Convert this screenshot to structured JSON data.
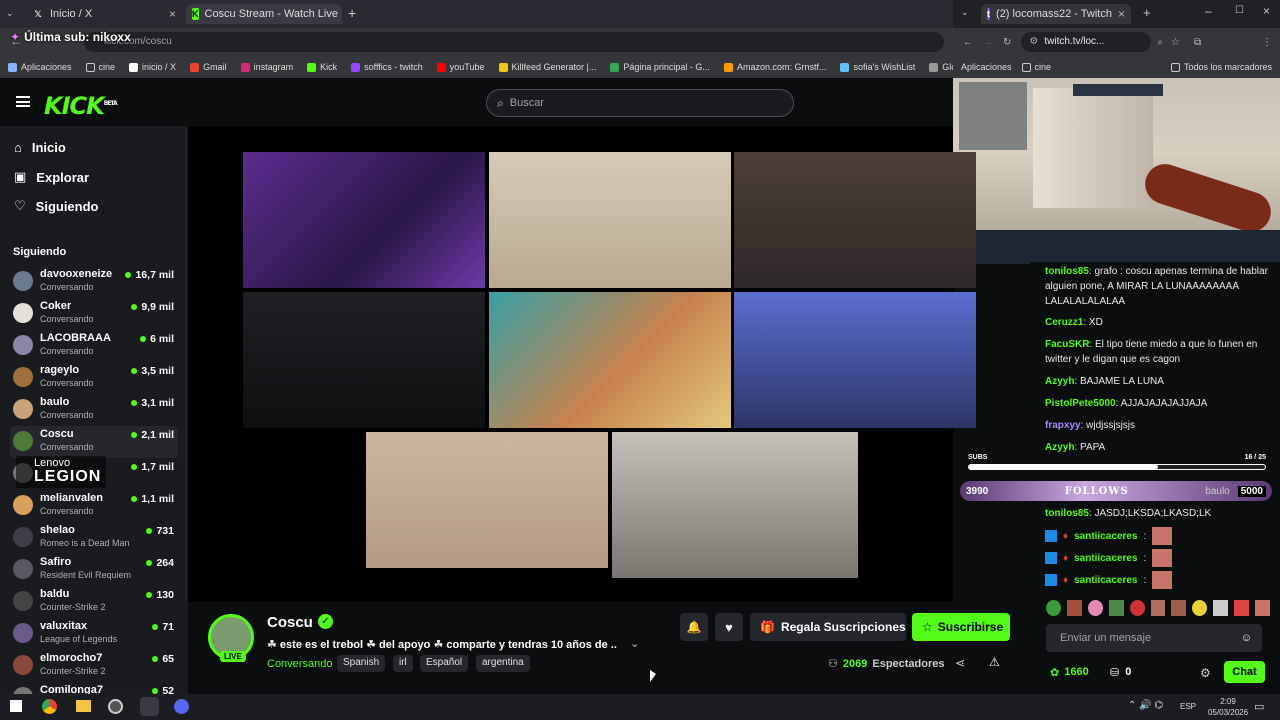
{
  "overlay": {
    "last_sub": "Última sub: nikoxx"
  },
  "browser_left": {
    "tabs": [
      {
        "label": "Inicio / X"
      },
      {
        "label": "Coscu Stream - Watch Live"
      }
    ],
    "url": "kick.com/coscu",
    "bookmarks": [
      "Aplicaciones",
      "cine",
      "inicio / X",
      "Gmail",
      "instagram",
      "Kick",
      "sofffics - twitch",
      "youTube",
      "Killfeed Generator |...",
      "Página principal - G...",
      "Amazon.com: Grnstf...",
      "sofia's WishList",
      "Glock-18 | Shinobi"
    ]
  },
  "browser_right": {
    "tab": "(2) locomass22 - Twitch",
    "url": "twitch.tv/loc...",
    "bookmarks": [
      "Aplicaciones",
      "cine",
      "Todos los marcadores"
    ]
  },
  "kick": {
    "logo": "KICK",
    "logo_badge": "BETA",
    "search_placeholder": "Buscar",
    "nav": [
      {
        "label": "Inicio",
        "icon": "home-icon"
      },
      {
        "label": "Explorar",
        "icon": "compass-icon"
      },
      {
        "label": "Siguiendo",
        "icon": "heart-icon"
      }
    ],
    "following_title": "Siguiendo",
    "following": [
      {
        "name": "davooxeneize",
        "category": "Conversando",
        "viewers": "16,7 mil"
      },
      {
        "name": "Coker",
        "category": "Conversando",
        "viewers": "9,9 mil"
      },
      {
        "name": "LACOBRAAA",
        "category": "Conversando",
        "viewers": "6 mil"
      },
      {
        "name": "rageylo",
        "category": "Conversando",
        "viewers": "3,5 mil"
      },
      {
        "name": "baulo",
        "category": "Conversando",
        "viewers": "3,1 mil"
      },
      {
        "name": "Coscu",
        "category": "Conversando",
        "viewers": "2,1 mil"
      },
      {
        "name": "",
        "category": "",
        "viewers": "1,7 mil"
      },
      {
        "name": "melianvalen",
        "category": "Conversando",
        "viewers": "1,1 mil"
      },
      {
        "name": "shelao",
        "category": "Romeo is a Dead Man",
        "viewers": "731"
      },
      {
        "name": "Safiro",
        "category": "Resident Evil Requiem",
        "viewers": "264"
      },
      {
        "name": "baldu",
        "category": "Counter-Strike 2",
        "viewers": "130"
      },
      {
        "name": "valuxitax",
        "category": "League of Legends",
        "viewers": "71"
      },
      {
        "name": "elmorocho7",
        "category": "Counter-Strike 2",
        "viewers": "65"
      },
      {
        "name": "Comilonga7",
        "category": "",
        "viewers": "52"
      }
    ],
    "sponsor": {
      "brand_small": "Lenovo",
      "brand_big": "LEGION"
    },
    "stream": {
      "channel": "Coscu",
      "live": "LIVE",
      "title": "☘ este es el trebol ☘ del apoyo ☘ comparte y tendras 10 años de ...",
      "category": "Conversando",
      "tags": [
        "Spanish",
        "irl",
        "Español",
        "argentina"
      ],
      "viewers_count": "2069",
      "viewers_label": "Espectadores",
      "gift_label": "Regala Suscripciones",
      "subscribe_label": "Suscribirse"
    }
  },
  "twitch": {
    "chat": [
      {
        "user": "tonilos85",
        "text": "grafo : coscu apenas termina de hablar alguien pone, A MIRAR LA LUNAAAAAAAA LALALALALALAA",
        "color": "#53fc18"
      },
      {
        "user": "Ceruzz1",
        "text": "XD",
        "color": "#53fc18"
      },
      {
        "user": "FacuSKR",
        "text": "El tipo tiene miedo a que lo funen en twitter y le digan que es cagon",
        "color": "#53fc18"
      },
      {
        "user": "Azyyh",
        "text": "BAJAME LA LUNA",
        "color": "#53fc18"
      },
      {
        "user": "PistolPete5000",
        "text": "AJJAJAJAJAJJAJA",
        "color": "#53fc18"
      },
      {
        "user": "frapxyy",
        "text": "wjdjssjsjsjs",
        "color": "#53fc18"
      },
      {
        "user": "Azyyh",
        "text": "PAPA",
        "color": "#53fc18"
      },
      {
        "user": "tonilos85",
        "text": "JASDJ;LKSDA;LKASD;LK",
        "color": "#53fc18"
      },
      {
        "user": "santiicaceres",
        "text": "",
        "color": "#53fc18"
      },
      {
        "user": "santiicaceres",
        "text": "",
        "color": "#53fc18"
      },
      {
        "user": "santiicaceres",
        "text": "",
        "color": "#53fc18"
      }
    ],
    "subs_label": "SUBS",
    "subs_progress": "16 / 25",
    "subs_fraction": 0.64,
    "follows_left": "3990",
    "follows_label": "FOLLOWS",
    "follows_right": "5000",
    "follows_hidden_name": "baulo",
    "message_placeholder": "Enviar un mensaje",
    "points": "1660",
    "bits": "0",
    "chat_button": "Chat"
  },
  "taskbar": {
    "lang": "ESP",
    "time": "2:09",
    "date": "05/03/2026"
  },
  "colors": {
    "kick_green": "#53fc18",
    "bg": "#0b0e0f",
    "sidebar": "#191b1f"
  }
}
